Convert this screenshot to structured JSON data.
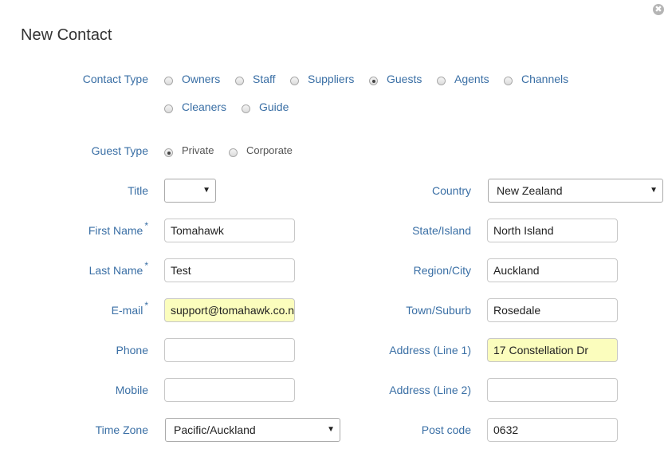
{
  "dialog": {
    "title": "New Contact",
    "close_glyph": "✖"
  },
  "contact_type": {
    "label": "Contact Type",
    "options": [
      "Owners",
      "Staff",
      "Suppliers",
      "Guests",
      "Agents",
      "Channels",
      "Cleaners",
      "Guide"
    ],
    "selected": "Guests"
  },
  "guest_type": {
    "label": "Guest Type",
    "options": [
      "Private",
      "Corporate"
    ],
    "selected": "Private"
  },
  "left_fields": {
    "title": {
      "label": "Title",
      "value": ""
    },
    "first_name": {
      "label": "First Name",
      "value": "Tomahawk",
      "required_mark": "*"
    },
    "last_name": {
      "label": "Last Name",
      "value": "Test",
      "required_mark": "*"
    },
    "email": {
      "label": "E-mail",
      "value": "support@tomahawk.co.nz",
      "required_mark": "*"
    },
    "phone": {
      "label": "Phone",
      "value": ""
    },
    "mobile": {
      "label": "Mobile",
      "value": ""
    },
    "time_zone": {
      "label": "Time Zone",
      "value": "Pacific/Auckland"
    }
  },
  "right_fields": {
    "country": {
      "label": "Country",
      "value": "New Zealand"
    },
    "state": {
      "label": "State/Island",
      "value": "North Island"
    },
    "region": {
      "label": "Region/City",
      "value": "Auckland"
    },
    "town": {
      "label": "Town/Suburb",
      "value": "Rosedale"
    },
    "address1": {
      "label": "Address (Line 1)",
      "value": "17 Constellation Dr"
    },
    "address2": {
      "label": "Address (Line 2)",
      "value": ""
    },
    "postcode": {
      "label": "Post code",
      "value": "0632"
    }
  },
  "caret_glyph": "▼",
  "highlight_color": "#fbfdbd",
  "label_color": "#3a6fa5"
}
